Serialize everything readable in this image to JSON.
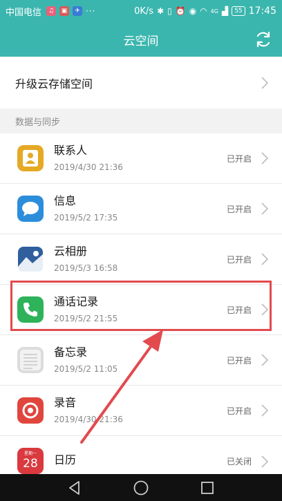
{
  "status_bar": {
    "carrier": "中国电信",
    "speed": "0K/s",
    "network": "4G",
    "battery": "55",
    "time": "17:45",
    "dots": "···"
  },
  "header": {
    "title": "云空间"
  },
  "upgrade": {
    "label": "升级云存储空间"
  },
  "section": {
    "title": "数据与同步"
  },
  "items": [
    {
      "title": "联系人",
      "time": "2019/4/30 21:36",
      "status": "已开启",
      "icon": "contacts-icon"
    },
    {
      "title": "信息",
      "time": "2019/5/2 17:35",
      "status": "已开启",
      "icon": "messages-icon"
    },
    {
      "title": "云相册",
      "time": "2019/5/3 16:58",
      "status": "已开启",
      "icon": "gallery-icon"
    },
    {
      "title": "通话记录",
      "time": "2019/5/2 21:55",
      "status": "已开启",
      "icon": "phone-icon"
    },
    {
      "title": "备忘录",
      "time": "2019/5/2 11:05",
      "status": "已开启",
      "icon": "notes-icon"
    },
    {
      "title": "录音",
      "time": "2019/4/30 21:36",
      "status": "已开启",
      "icon": "recorder-icon"
    },
    {
      "title": "日历",
      "time": "",
      "status": "已关闭",
      "icon": "calendar-icon",
      "calendar_day": "28",
      "calendar_header": "星期一"
    }
  ],
  "colors": {
    "accent": "#3bb6ae",
    "highlight": "#e24a4e"
  }
}
